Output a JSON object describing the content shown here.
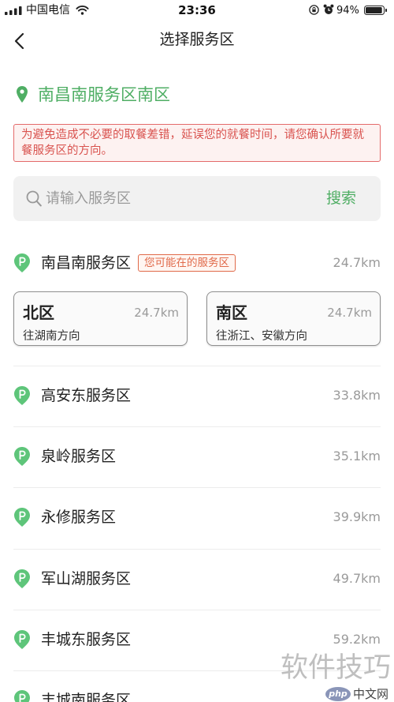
{
  "status_bar": {
    "carrier": "中国电信",
    "time": "23:36",
    "battery": "94%",
    "battery_level": 0.94
  },
  "nav": {
    "title": "选择服务区"
  },
  "location": {
    "name": "南昌南服务区南区"
  },
  "notice": {
    "text": "为避免造成不必要的取餐差错，延误您的就餐时间，请您确认所要就餐服务区的方向。"
  },
  "search": {
    "placeholder": "请输入服务区",
    "button_label": "搜索"
  },
  "current": {
    "name": "南昌南服务区",
    "tag": "您可能在的服务区",
    "distance": "24.7km",
    "zones": [
      {
        "name": "北区",
        "distance": "24.7km",
        "direction": "往湖南方向"
      },
      {
        "name": "南区",
        "distance": "24.7km",
        "direction": "往浙江、安徽方向"
      }
    ]
  },
  "list": [
    {
      "name": "高安东服务区",
      "distance": "33.8km"
    },
    {
      "name": "泉岭服务区",
      "distance": "35.1km"
    },
    {
      "name": "永修服务区",
      "distance": "39.9km"
    },
    {
      "name": "军山湖服务区",
      "distance": "49.7km"
    },
    {
      "name": "丰城东服务区",
      "distance": "59.2km"
    },
    {
      "name": "丰城南服务区"
    }
  ],
  "watermark": {
    "text": "软件技巧",
    "logo_php": "php",
    "logo_cn": "中文网"
  },
  "colors": {
    "accent": "#4fae64",
    "icon_green": "#5ec57a",
    "notice_text": "#d9534f",
    "notice_border": "#e46b6b",
    "notice_bg": "#fdf2f1",
    "tag": "#e06a4a",
    "muted": "#9a9a9a"
  },
  "icons": {
    "back": "chevron-left-icon",
    "location": "map-pin-icon",
    "search": "search-icon",
    "service_area": "service-area-pin-icon",
    "signal": "signal-icon",
    "wifi": "wifi-icon",
    "rotation_lock": "rotation-lock-icon",
    "alarm": "alarm-icon",
    "battery": "battery-icon"
  }
}
